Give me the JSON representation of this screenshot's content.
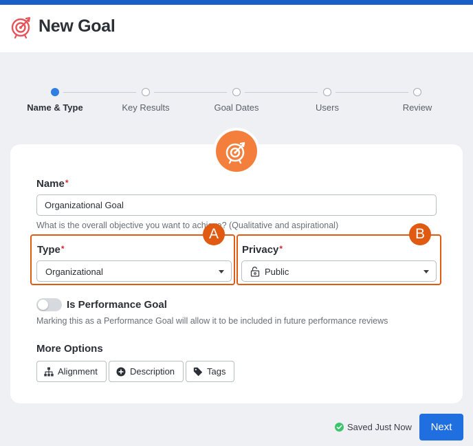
{
  "header": {
    "title": "New Goal",
    "logo_icon": "target-arrow-icon"
  },
  "stepper": {
    "steps": [
      {
        "label": "Name & Type",
        "state": "active"
      },
      {
        "label": "Key Results",
        "state": "pending"
      },
      {
        "label": "Goal Dates",
        "state": "pending"
      },
      {
        "label": "Users",
        "state": "pending"
      },
      {
        "label": "Review",
        "state": "pending"
      }
    ]
  },
  "form": {
    "badge_icon": "target-arrow-icon",
    "name": {
      "label": "Name",
      "required_mark": "*",
      "value": "Organizational Goal",
      "hint": "What is the overall objective you want to achieve? (Qualitative and aspirational)"
    },
    "type": {
      "label": "Type",
      "required_mark": "*",
      "value": "Organizational"
    },
    "privacy": {
      "label": "Privacy",
      "required_mark": "*",
      "value": "Public",
      "icon": "lock-icon"
    },
    "performance": {
      "label": "Is Performance Goal",
      "enabled": false,
      "hint": "Marking this as a Performance Goal will allow it to be included in future performance reviews"
    },
    "more_options": {
      "label": "More Options",
      "buttons": [
        {
          "label": "Alignment",
          "icon": "hierarchy-icon"
        },
        {
          "label": "Description",
          "icon": "plus-circle-icon"
        },
        {
          "label": "Tags",
          "icon": "tag-icon"
        }
      ]
    }
  },
  "callouts": {
    "a": "A",
    "b": "B"
  },
  "footer": {
    "saved_text": "Saved Just Now",
    "next_label": "Next"
  },
  "colors": {
    "accent": "#1f6fe0",
    "brand": "#f47e3c",
    "callout": "#e05a12",
    "saved": "#3ec46d"
  }
}
